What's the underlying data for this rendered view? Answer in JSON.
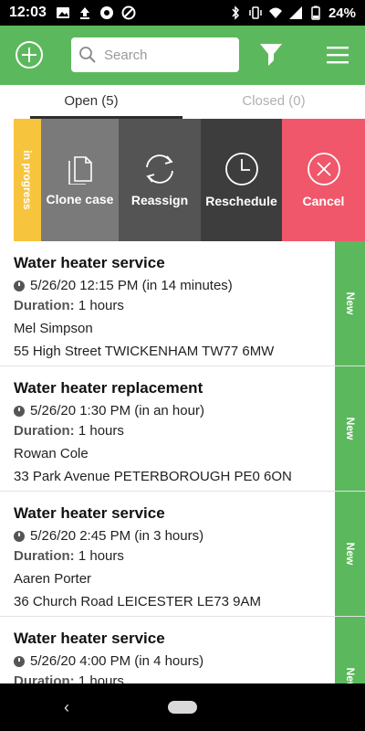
{
  "statusbar": {
    "time": "12:03",
    "battery": "24%"
  },
  "appbar": {
    "search_placeholder": "Search"
  },
  "tabs": [
    {
      "label": "Open (5)"
    },
    {
      "label": "Closed (0)"
    }
  ],
  "actions": {
    "status_label": "in progress",
    "clone": "Clone case",
    "reassign": "Reassign",
    "reschedule": "Reschedule",
    "cancel": "Cancel"
  },
  "jobs": [
    {
      "title": "Water heater service",
      "when": "5/26/20 12:15 PM (in 14 minutes)",
      "duration_label": "Duration:",
      "duration": "1 hours",
      "name": "Mel Simpson",
      "address": "55 High Street TWICKENHAM TW77 6MW",
      "badge": "New"
    },
    {
      "title": "Water heater replacement",
      "when": "5/26/20 1:30 PM (in an hour)",
      "duration_label": "Duration:",
      "duration": "1 hours",
      "name": "Rowan Cole",
      "address": "33 Park Avenue PETERBOROUGH PE0 6ON",
      "badge": "New"
    },
    {
      "title": "Water heater service",
      "when": "5/26/20 2:45 PM (in 3 hours)",
      "duration_label": "Duration:",
      "duration": "1 hours",
      "name": "Aaren Porter",
      "address": "36 Church Road LEICESTER LE73 9AM",
      "badge": "New"
    },
    {
      "title": "Water heater service",
      "when": "5/26/20 4:00 PM (in 4 hours)",
      "duration_label": "Duration:",
      "duration": "1 hours",
      "name": "",
      "address": "",
      "badge": "New"
    }
  ],
  "colors": {
    "appbar": "#5cb85c",
    "in_progress": "#f7c43e",
    "cancel": "#f0576b",
    "badge": "#5cb85c"
  }
}
